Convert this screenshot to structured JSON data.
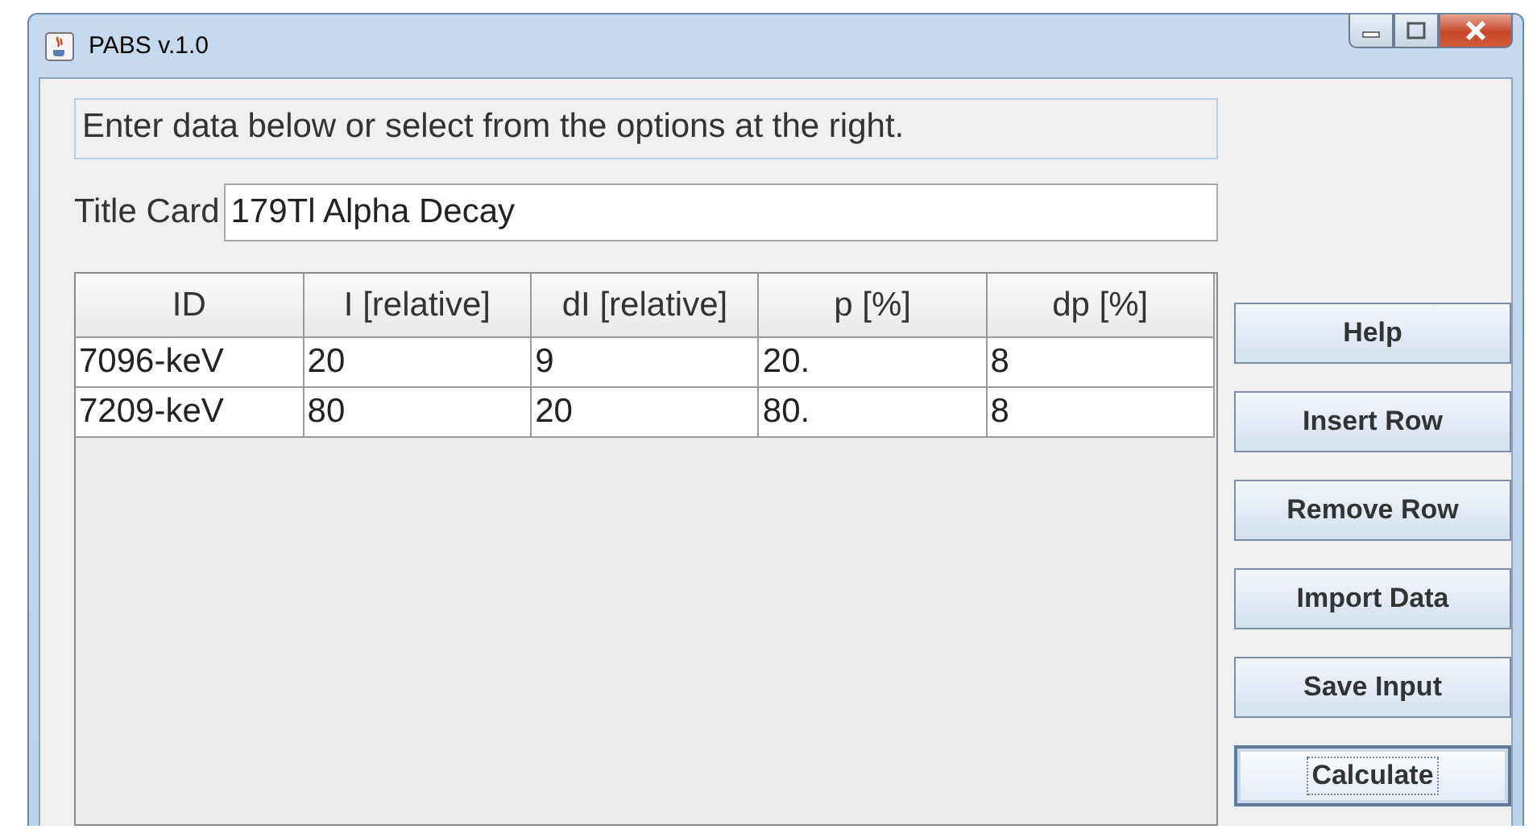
{
  "window": {
    "title": "PABS v.1.0"
  },
  "instructions": "Enter data below or select from the options at the right.",
  "title_card": {
    "label": "Title Card",
    "value": "179Tl Alpha Decay"
  },
  "table": {
    "columns": [
      "ID",
      "I [relative]",
      "dI [relative]",
      "p [%]",
      "dp [%]"
    ],
    "rows": [
      [
        "7096-keV",
        "20",
        "9",
        "20.",
        "8"
      ],
      [
        "7209-keV",
        "80",
        "20",
        "80.",
        "8"
      ]
    ]
  },
  "buttons": [
    {
      "label": "Help",
      "focused": false
    },
    {
      "label": "Insert Row",
      "focused": false
    },
    {
      "label": "Remove Row",
      "focused": false
    },
    {
      "label": "Import Data",
      "focused": false
    },
    {
      "label": "Save Input",
      "focused": false
    },
    {
      "label": "Calculate",
      "focused": true
    }
  ]
}
